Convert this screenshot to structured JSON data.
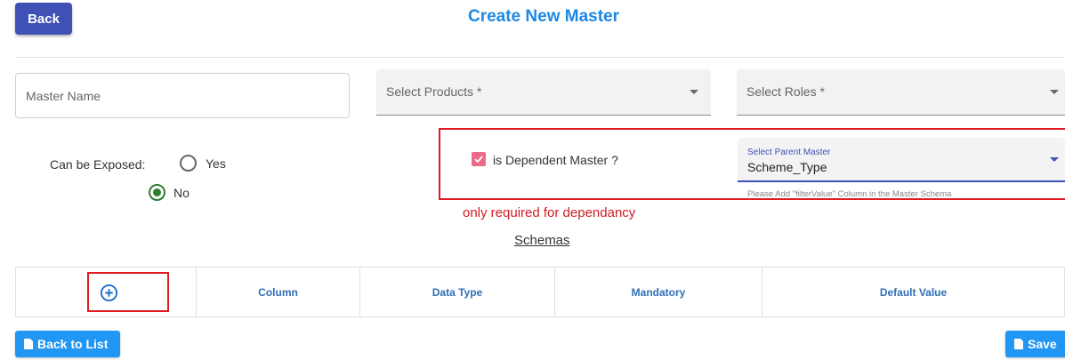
{
  "header": {
    "back_label": "Back",
    "title": "Create New Master"
  },
  "form": {
    "master_name_placeholder": "Master Name",
    "products_label": "Select Products *",
    "roles_label": "Select Roles *",
    "exposed_label": "Can be Exposed:",
    "exposed_options": [
      "Yes",
      "No"
    ],
    "exposed_selected": "No",
    "dependent_label": "is Dependent Master ?",
    "dependent_checked": true,
    "parent_master_label": "Select Parent Master",
    "parent_master_value": "Scheme_Type",
    "parent_master_helper": "Please Add \"filterValue\" Column in the Master Schema",
    "dependency_note": "only required for dependancy"
  },
  "schemas": {
    "title": "Schemas",
    "columns": [
      "Column",
      "Data Type",
      "Mandatory",
      "Default Value"
    ],
    "add_icon": "plus-circle-icon"
  },
  "footer": {
    "back_to_list_label": "Back to List",
    "save_label": "Save"
  },
  "colors": {
    "primary": "#3f51b5",
    "title": "#1e88e5",
    "button_blue": "#2196f3",
    "annotation_red": "#e01b24",
    "checkbox": "#ec6b8a",
    "radio_selected": "#2e7d32"
  }
}
